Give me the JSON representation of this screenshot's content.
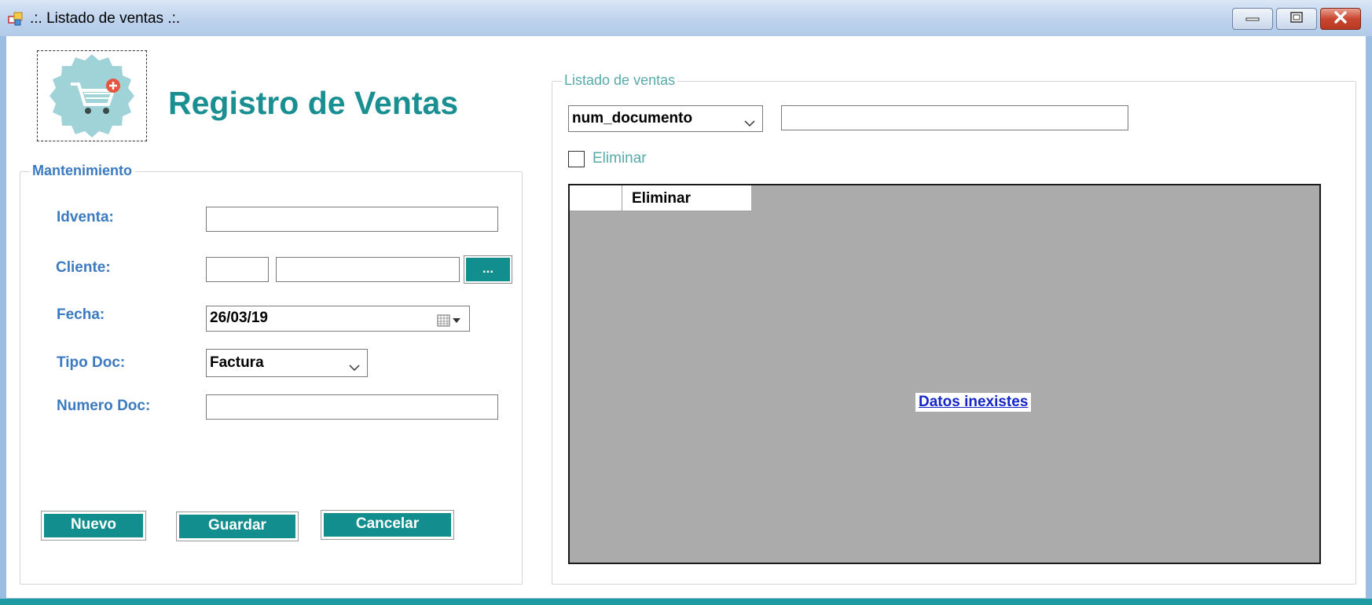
{
  "window": {
    "title": ".:. Listado de ventas .:."
  },
  "header": {
    "title": "Registro de Ventas"
  },
  "mantenimiento": {
    "legend": "Mantenimiento",
    "idventa_label": "Idventa:",
    "idventa_value": "",
    "cliente_label": "Cliente:",
    "cliente_id_value": "",
    "cliente_name_value": "",
    "cliente_button": "...",
    "fecha_label": "Fecha:",
    "fecha_value": "26/03/19",
    "tipo_doc_label": "Tipo Doc:",
    "tipo_doc_value": "Factura",
    "numero_doc_label": "Numero Doc:",
    "numero_doc_value": "",
    "buttons": {
      "nuevo": "Nuevo",
      "guardar": "Guardar",
      "cancelar": "Cancelar"
    }
  },
  "listado": {
    "legend": "Listado de ventas",
    "filter_field": "num_documento",
    "search_value": "",
    "eliminar_checkbox_label": "Eliminar",
    "eliminar_checked": false,
    "grid_columns": [
      "Eliminar"
    ],
    "empty_message": "Datos inexistes"
  },
  "colors": {
    "accent": "#138e8e",
    "title": "#198f91",
    "label": "#3b7ac0",
    "grid_bg": "#ababab",
    "link": "#1426c8"
  }
}
